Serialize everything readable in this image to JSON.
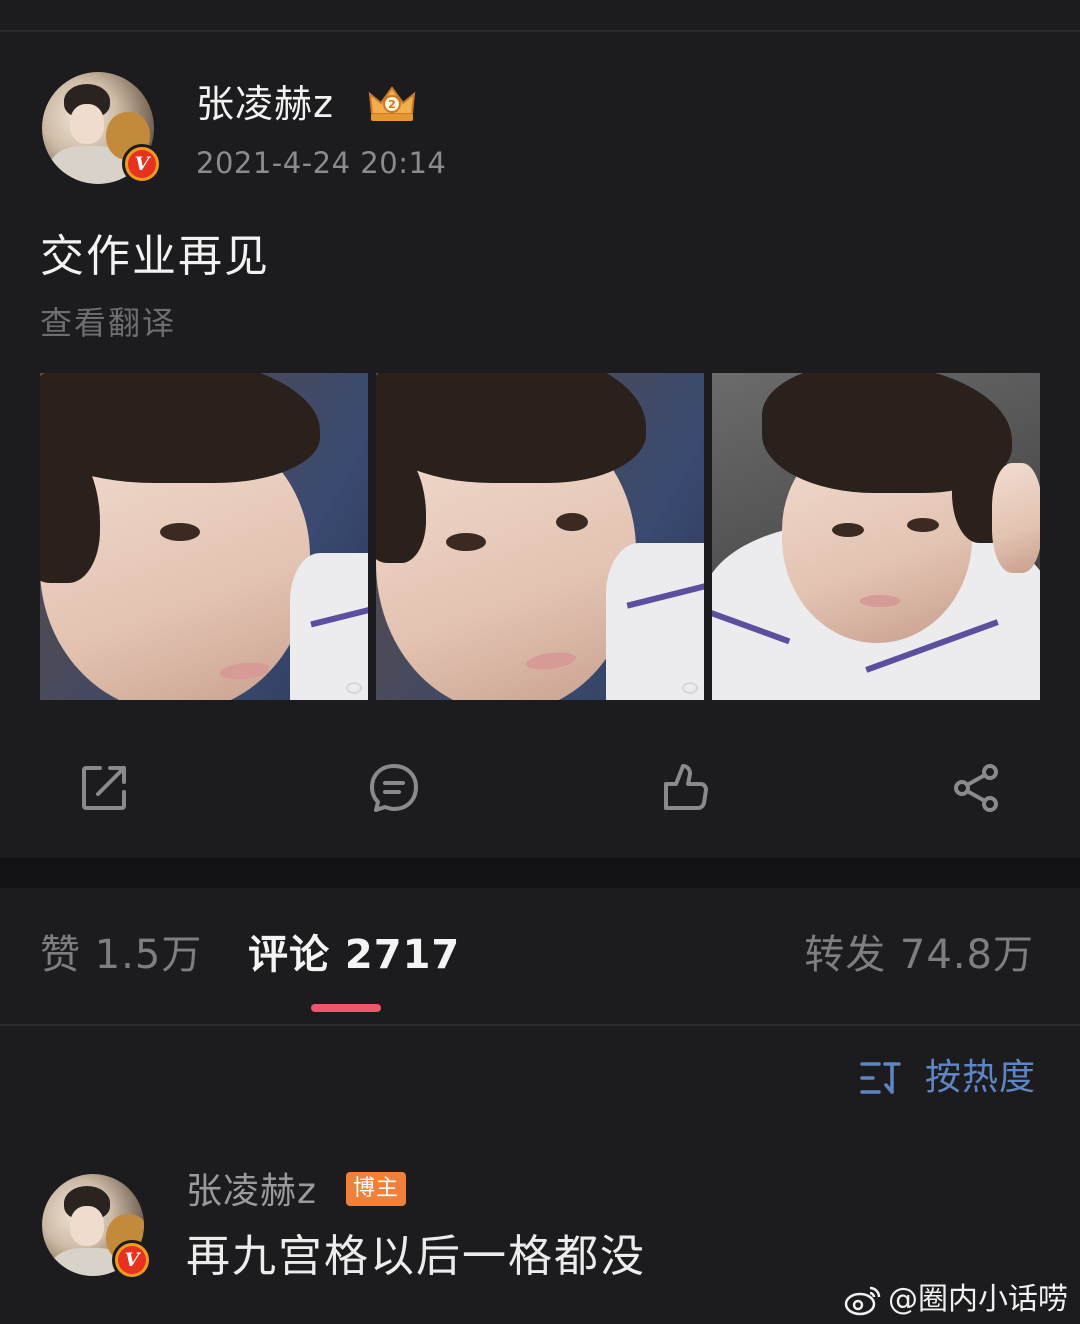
{
  "post": {
    "username": "张凌赫z",
    "timestamp": "2021-4-24 20:14",
    "text": "交作业再见",
    "translate_link": "查看翻译",
    "photos": [
      {
        "alt": "selfie-photo-1"
      },
      {
        "alt": "selfie-photo-2"
      },
      {
        "alt": "selfie-photo-3"
      }
    ],
    "verified_mark": "V"
  },
  "actions": {
    "repost_icon": "repost-icon",
    "comment_icon": "comment-icon",
    "like_icon": "like-icon",
    "share_icon": "share-icon"
  },
  "tabs": {
    "like": "赞 1.5万",
    "comment": "评论 2717",
    "repost": "转发 74.8万",
    "active": "comment"
  },
  "sort": {
    "label": "按热度"
  },
  "comment": {
    "username": "张凌赫z",
    "author_tag": "博主",
    "text": "再九宫格以后一格都没",
    "verified_mark": "V"
  },
  "watermark": {
    "text": "@圈内小话唠"
  },
  "colors": {
    "background": "#1c1c1e",
    "accent_pink": "#f0566b",
    "sort_blue": "#5f86c4",
    "author_tag": "#f0803a",
    "verified": "#e8321f"
  }
}
